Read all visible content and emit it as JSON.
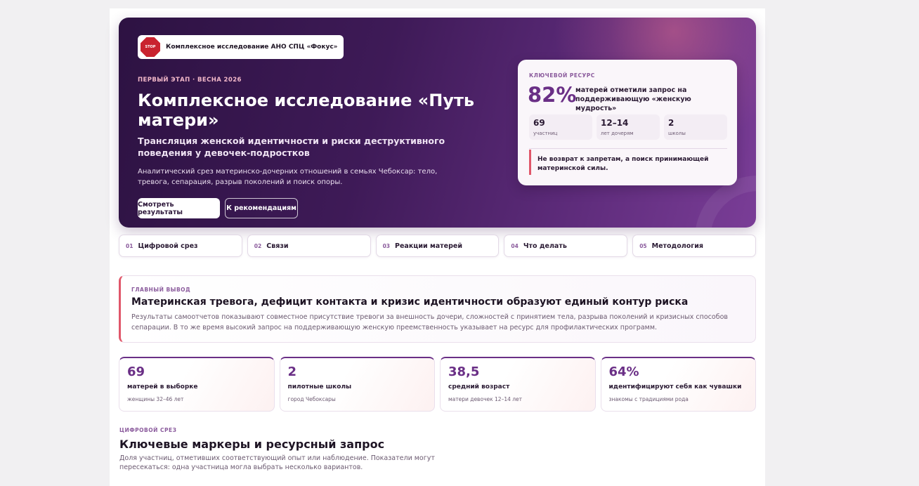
{
  "hero": {
    "brand": {
      "logo_text": "STOP",
      "name": "Комплексное исследование АНО СПЦ «Фокус»"
    },
    "eyebrow": "ПЕРВЫЙ ЭТАП · ВЕСНА 2026",
    "title": "Комплексное исследование «Путь матери»",
    "subtitle": "Трансляция женской идентичности и риски деструктивного поведения у девочек-подростков",
    "description": "Аналитический срез материнско-дочерних отношений в семьях Чебоксар: тело, тревога, сепарация, разрыв поколений и поиск опоры.",
    "primary_button": "Смотреть результаты",
    "secondary_button": "К рекомендациям"
  },
  "resource_card": {
    "label": "КЛЮЧЕВОЙ РЕСУРС",
    "big_value": "82%",
    "big_text": "матерей отметили запрос на поддерживающую «женскую мудрость»",
    "stats": [
      {
        "value": "69",
        "label": "участниц"
      },
      {
        "value": "12–14",
        "label": "лет дочерям"
      },
      {
        "value": "2",
        "label": "школы"
      }
    ],
    "quote": "Не возврат к запретам, а поиск принимающей материнской силы."
  },
  "nav": [
    {
      "num": "01",
      "label": "Цифровой срез"
    },
    {
      "num": "02",
      "label": "Связи"
    },
    {
      "num": "03",
      "label": "Реакции матерей"
    },
    {
      "num": "04",
      "label": "Что делать"
    },
    {
      "num": "05",
      "label": "Методология"
    }
  ],
  "finding": {
    "label": "ГЛАВНЫЙ ВЫВОД",
    "title": "Материнская тревога, дефицит контакта и кризис идентичности образуют единый контур риска",
    "text": "Результаты самоотчетов показывают совместное присутствие тревоги за внешность дочери, сложностей с принятием тела, разрыва поколений и кризисных способов сепарации. В то же время высокий запрос на поддерживающую женскую преемственность указывает на ресурс для профилактических программ."
  },
  "stat_cards": [
    {
      "value": "69",
      "title": "матерей в выборке",
      "sub": "женщины 32–46 лет"
    },
    {
      "value": "2",
      "title": "пилотные школы",
      "sub": "город Чебоксары"
    },
    {
      "value": "38,5",
      "title": "средний возраст",
      "sub": "матери девочек 12–14 лет"
    },
    {
      "value": "64%",
      "title": "идентифицируют себя как чувашки",
      "sub": "знакомы с традициями рода"
    }
  ],
  "section": {
    "eyebrow": "ЦИФРОВОЙ СРЕЗ",
    "title": "Ключевые маркеры и ресурсный запрос",
    "description": "Доля участниц, отметивших соответствующий опыт или наблюдение. Показатели могут пересекаться: одна участница могла выбрать несколько вариантов."
  }
}
